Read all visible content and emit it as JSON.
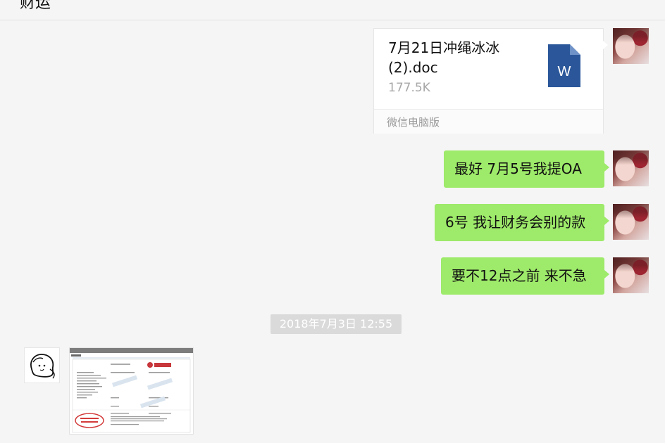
{
  "header": {
    "title": "财运",
    "more_label": "···"
  },
  "messages": [
    {
      "type": "file",
      "sender": "self",
      "file_name": "7月21日冲绳冰冰(2).doc",
      "file_size": "177.5K",
      "source": "微信电脑版",
      "icon": "word-doc-icon"
    },
    {
      "type": "text",
      "sender": "self",
      "text": "最好 7月5号我提OA"
    },
    {
      "type": "text",
      "sender": "self",
      "text": "6号 我让财务会别的款"
    },
    {
      "type": "text",
      "sender": "self",
      "text": "要不12点之前 来不急"
    },
    {
      "type": "timestamp",
      "text": "2018年7月3日 12:55"
    },
    {
      "type": "image",
      "sender": "other",
      "description": "bank receipt"
    }
  ],
  "colors": {
    "bubble_self": "#9eea6a",
    "background": "#f5f5f5",
    "word_blue": "#2b579a",
    "stamp_red": "#d33a3a"
  }
}
